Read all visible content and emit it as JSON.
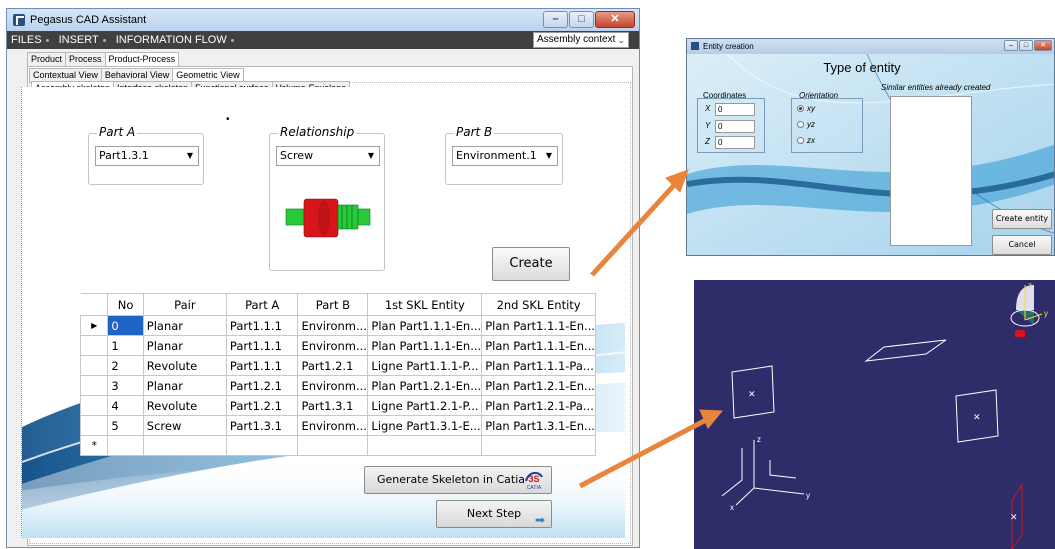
{
  "window": {
    "title": "Pegasus CAD Assistant",
    "min": "–",
    "max": "□",
    "close": "✕"
  },
  "menu": {
    "files": "FILES",
    "insert": "INSERT",
    "info_flow": "INFORMATION FLOW",
    "context": "Assembly context"
  },
  "tabs_level1": [
    "Product",
    "Process",
    "Product-Process"
  ],
  "tabs_level2": [
    "Contextual View",
    "Behavioral View",
    "Geometric View"
  ],
  "tabs_level3": [
    "Assembly skeleton",
    "Interface skeleton",
    "Functional surface",
    "Volume-Envelope"
  ],
  "part_a": {
    "label": "Part A",
    "value": "Part1.3.1"
  },
  "relationship": {
    "label": "Relationship",
    "value": "Screw"
  },
  "part_b": {
    "label": "Part B",
    "value": "Environment.1"
  },
  "create_label": "Create",
  "table": {
    "headers": [
      "No",
      "Pair",
      "Part A",
      "Part B",
      "1st SKL Entity",
      "2nd SKL Entity"
    ],
    "rows": [
      [
        "0",
        "Planar",
        "Part1.1.1",
        "Environm...",
        "Plan Part1.1.1-En...",
        "Plan Part1.1.1-En..."
      ],
      [
        "1",
        "Planar",
        "Part1.1.1",
        "Environm...",
        "Plan Part1.1.1-En...",
        "Plan Part1.1.1-En..."
      ],
      [
        "2",
        "Revolute",
        "Part1.1.1",
        "Part1.2.1",
        "Ligne Part1.1.1-P...",
        "Plan Part1.1.1-Pa..."
      ],
      [
        "3",
        "Planar",
        "Part1.2.1",
        "Environm...",
        "Plan Part1.2.1-En...",
        "Plan Part1.2.1-En..."
      ],
      [
        "4",
        "Revolute",
        "Part1.2.1",
        "Part1.3.1",
        "Ligne Part1.2.1-P...",
        "Plan Part1.2.1-Pa..."
      ],
      [
        "5",
        "Screw",
        "Part1.3.1",
        "Environm...",
        "Ligne Part1.3.1-E...",
        "Plan Part1.3.1-En..."
      ]
    ],
    "selected_marker": "▶",
    "new_row_marker": "*"
  },
  "generate_label": "Generate Skeleton in Catia",
  "catia_logo_text": "CATIA",
  "next_step_label": "Next Step",
  "entity_window": {
    "title": "Entity creation",
    "heading": "Type of entity",
    "coordinates_label": "Coordinates",
    "x_label": "X",
    "y_label": "Y",
    "z_label": "Z",
    "x_value": "0",
    "y_value": "0",
    "z_value": "0",
    "orientation_label": "Orientation",
    "orient_xy": "xy",
    "orient_yz": "yz",
    "orient_zx": "zx",
    "similar_label": "Similar entities already created",
    "create_entity_label": "Create entity",
    "cancel_label": "Cancel"
  },
  "catia_view": {
    "axis_z": "z",
    "axis_y": "y",
    "axis_x": "x",
    "compass_z": "z",
    "compass_y": "y"
  },
  "colors": {
    "accent_arrow": "#e8843c",
    "selection_blue": "#1f63c4",
    "catia_bg": "#2f2c6a",
    "screw_red": "#d8151b",
    "screw_green": "#27c93a"
  }
}
